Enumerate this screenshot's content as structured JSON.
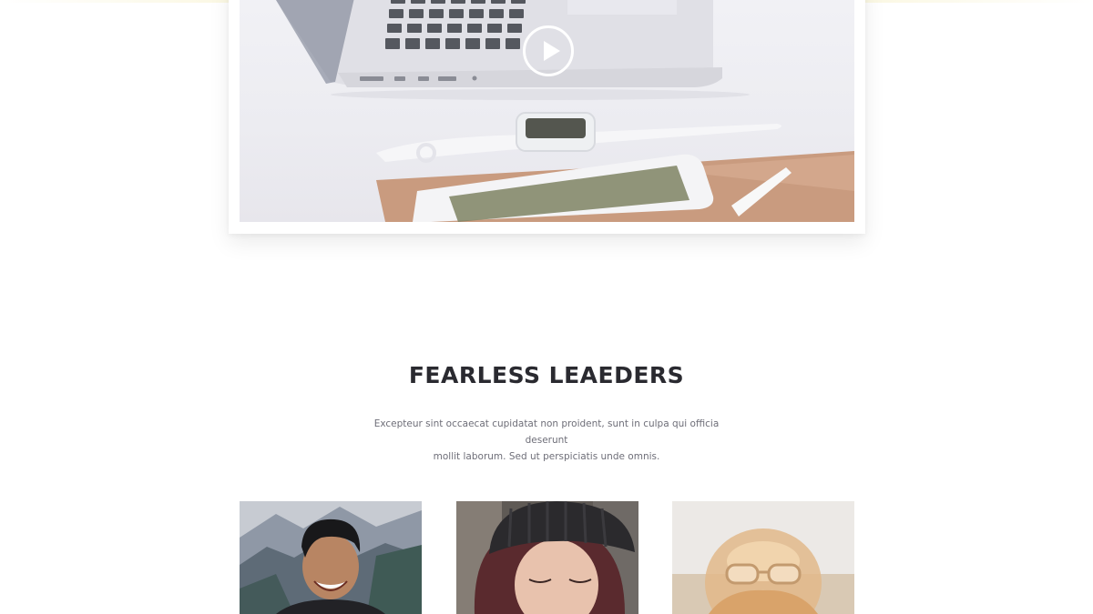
{
  "video": {
    "play_icon": "play-icon"
  },
  "leaders": {
    "title": "FEARLESS LEAEDERS",
    "description_line1": "Excepteur sint occaecat cupidatat non proident, sunt in culpa qui officia deserunt",
    "description_line2": "mollit laborum. Sed ut perspiciatis unde omnis.",
    "members": [
      {
        "photo": "smiling-man-mountains-photo"
      },
      {
        "photo": "woman-beanie-photo"
      },
      {
        "photo": "sunglasses-cap-photo"
      }
    ]
  },
  "colors": {
    "heading": "#2a2a30",
    "body_text": "#6e6e78",
    "top_accent": "#fbf8e4"
  }
}
